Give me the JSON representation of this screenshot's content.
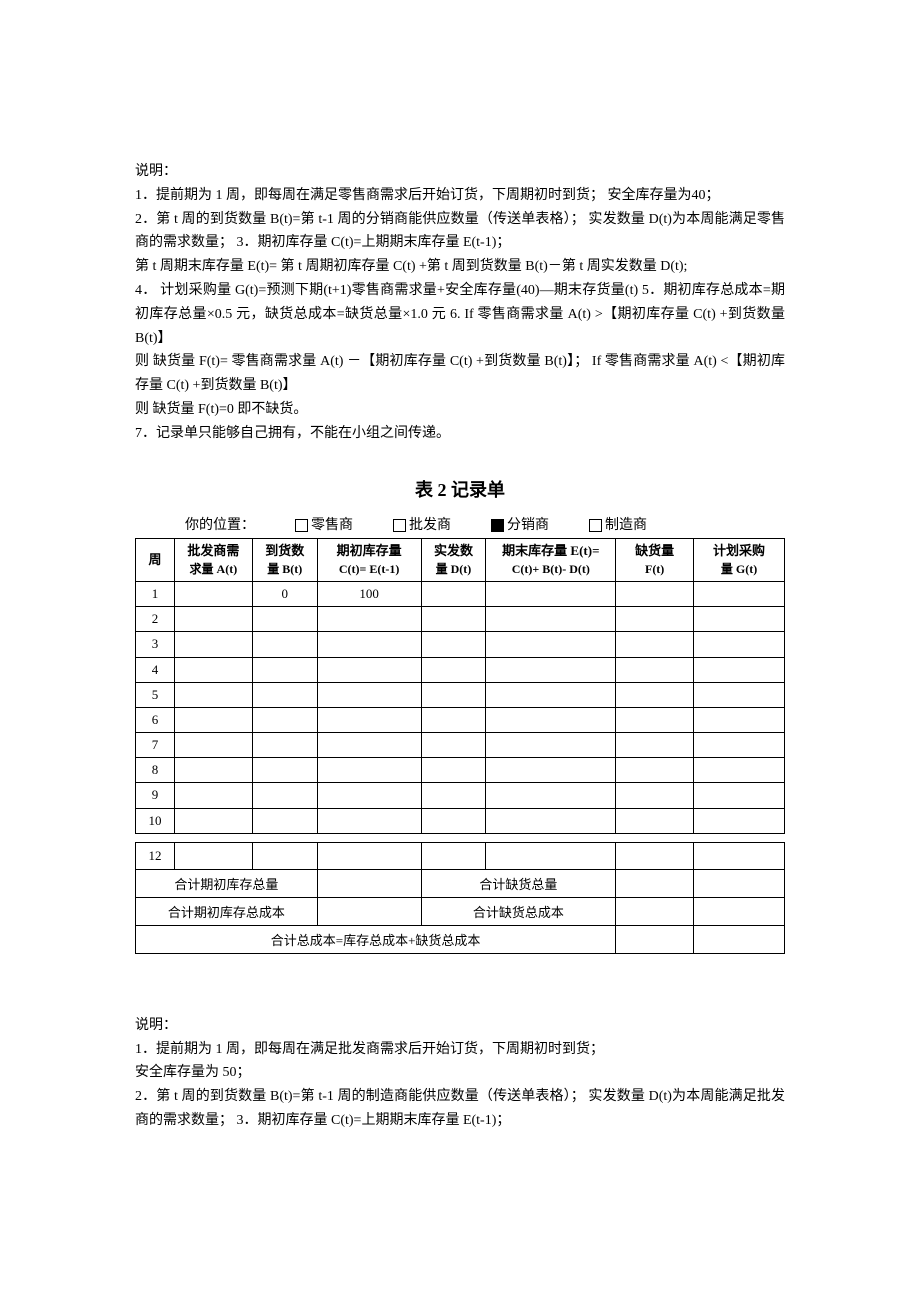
{
  "section1": {
    "heading": "说明：",
    "l1": "1．提前期为 1 周，即每周在满足零售商需求后开始订货，下周期初时到货； 安全库存量为40；",
    "l2": "2．第 t 周的到货数量 B(t)=第 t-1 周的分销商能供应数量（传送单表格）； 实发数量 D(t)为本周能满足零售商的需求数量； 3．期初库存量 C(t)=上期期末库存量 E(t-1)；",
    "l3": "  第 t 周期末库存量 E(t)= 第 t 周期初库存量 C(t) +第 t 周到货数量 B(t)－第 t 周实发数量 D(t);",
    "l4": "4． 计划采购量 G(t)=预测下期(t+1)零售商需求量+安全库存量(40)—期末存货量(t) 5．期初库存总成本=期初库存总量×0.5 元，缺货总成本=缺货总量×1.0 元   6. If 零售商需求量 A(t) >【期初库存量 C(t) +到货数量 B(t)】",
    "l5": "则  缺货量 F(t)= 零售商需求量 A(t) －【期初库存量 C(t) +到货数量 B(t)】；       If  零售商需求量 A(t) <【期初库存量 C(t) +到货数量 B(t)】",
    "l6": "则  缺货量 F(t)=0    即不缺货。",
    "l7": "7．记录单只能够自己拥有，不能在小组之间传递。"
  },
  "table2": {
    "title": "表 2   记录单",
    "position_label": "你的位置：",
    "opt1": "零售商",
    "opt2": "批发商",
    "opt3": "分销商",
    "opt4": "制造商",
    "header": {
      "c1": "周",
      "c2a": "批发商需",
      "c2b": "求量 A(t)",
      "c3a": "到货数",
      "c3b": "量 B(t)",
      "c4a": "期初库存量",
      "c4b": "C(t)= E(t-1)",
      "c5a": "实发数",
      "c5b": "量 D(t)",
      "c6a": "期末库存量 E(t)=",
      "c6b": "C(t)+ B(t)- D(t)",
      "c7a": "缺货量",
      "c7b": "F(t)",
      "c8a": "计划采购",
      "c8b": "量 G(t)"
    },
    "rows": [
      {
        "n": "1",
        "b": "0",
        "c": "100"
      },
      {
        "n": "2"
      },
      {
        "n": "3"
      },
      {
        "n": "4"
      },
      {
        "n": "5"
      },
      {
        "n": "6"
      },
      {
        "n": "7"
      },
      {
        "n": "8"
      },
      {
        "n": "9"
      },
      {
        "n": "10"
      }
    ],
    "row12": "12",
    "sum1": "合计期初库存总量",
    "sum2": "合计缺货总量",
    "sum3": "合计期初库存总成本",
    "sum4": "合计缺货总成本",
    "sum5": "合计总成本=库存总成本+缺货总成本"
  },
  "section2": {
    "heading": "说明：",
    "l1": "1．提前期为 1 周，即每周在满足批发商需求后开始订货，下周期初时到货；",
    "l2": "安全库存量为 50；",
    "l3": "2．第 t 周的到货数量 B(t)=第 t-1 周的制造商能供应数量（传送单表格）； 实发数量 D(t)为本周能满足批发商的需求数量； 3．期初库存量 C(t)=上期期末库存量 E(t-1)；"
  }
}
